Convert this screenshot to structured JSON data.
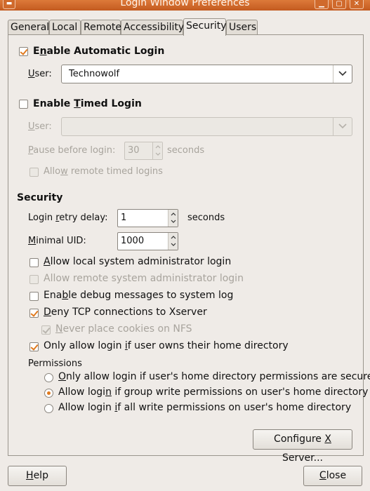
{
  "window": {
    "title": "Login Window Preferences"
  },
  "tabs": [
    {
      "label": "General"
    },
    {
      "label": "Local"
    },
    {
      "label": "Remote"
    },
    {
      "label": "Accessibility"
    },
    {
      "label": "Security"
    },
    {
      "label": "Users"
    }
  ],
  "automatic_login": {
    "label_pre": "E",
    "label_mnemonic": "n",
    "label_post": "able Automatic Login",
    "checked": true,
    "user_label_mnemonic": "U",
    "user_label_post": "ser:",
    "user_value": "Technowolf"
  },
  "timed_login": {
    "label_pre": "Enable ",
    "label_mnemonic": "T",
    "label_post": "imed Login",
    "checked": false,
    "user_label_mnemonic": "U",
    "user_label_post": "ser:",
    "user_value": "",
    "pause_label_mnemonic": "P",
    "pause_label_post": "ause before login:",
    "pause_value": "30",
    "pause_unit": "seconds",
    "allow_remote_pre": "Allo",
    "allow_remote_mnemonic": "w",
    "allow_remote_post": " remote timed logins"
  },
  "security": {
    "heading": "Security",
    "retry_label_pre": "Login ",
    "retry_label_mnemonic": "r",
    "retry_label_post": "etry delay:",
    "retry_value": "1",
    "retry_unit": "seconds",
    "uid_label_mnemonic": "M",
    "uid_label_post": "inimal UID:",
    "uid_value": "1000",
    "options": [
      {
        "pre": "",
        "mn": "A",
        "post": "llow local system administrator login"
      },
      {
        "pre": "",
        "mn": "",
        "post": "Allow remote system administrator login"
      },
      {
        "pre": "Ena",
        "mn": "b",
        "post": "le debug messages to system log"
      },
      {
        "pre": "",
        "mn": "D",
        "post": "eny TCP connections to Xserver"
      },
      {
        "pre": "",
        "mn": "N",
        "post": "ever place cookies on NFS"
      },
      {
        "pre": "Only allow login ",
        "mn": "i",
        "post": "f user owns their home directory"
      }
    ],
    "permissions_heading": "Permissions",
    "permissions": [
      {
        "pre": "",
        "mn": "O",
        "post": "nly allow login if user's home directory permissions are secure"
      },
      {
        "pre": "Allow logi",
        "mn": "n",
        "post": " if group write permissions on user's home directory"
      },
      {
        "pre": "Allow login ",
        "mn": "i",
        "post": "f all write permissions on user's home directory"
      }
    ],
    "configure_pre": "Configure ",
    "configure_mnemonic": "X",
    "configure_post": " Server..."
  },
  "footer": {
    "help_mnemonic": "H",
    "help_post": "elp",
    "close_mnemonic": "C",
    "close_post": "lose"
  },
  "colors": {
    "accent": "#e07a1f",
    "titlebar": "#d06a2c",
    "background": "#efebe7"
  }
}
